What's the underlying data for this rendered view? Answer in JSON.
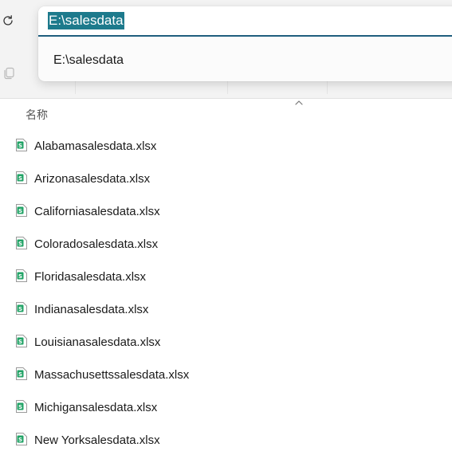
{
  "toolbar": {
    "refresh_icon": "refresh-icon",
    "copy_icon": "copy-icon"
  },
  "address_bar": {
    "value": "E:\\salesdata",
    "suggestions": [
      "E:\\salesdata"
    ]
  },
  "file_list": {
    "column_header": "名称",
    "sort_direction": "ascending",
    "file_icon": "excel-file-icon",
    "files": [
      "Alabamasalesdata.xlsx",
      "Arizonasalesdata.xlsx",
      "Californiasalesdata.xlsx",
      "Coloradosalesdata.xlsx",
      "Floridasalesdata.xlsx",
      "Indianasalesdata.xlsx",
      "Louisianasalesdata.xlsx",
      "Massachusettssalesdata.xlsx",
      "Michigansalesdata.xlsx",
      "New Yorksalesdata.xlsx"
    ]
  },
  "colors": {
    "selection": "#1d7a8c",
    "focus_underline": "#1f5e7e",
    "excel_green": "#21a366"
  }
}
